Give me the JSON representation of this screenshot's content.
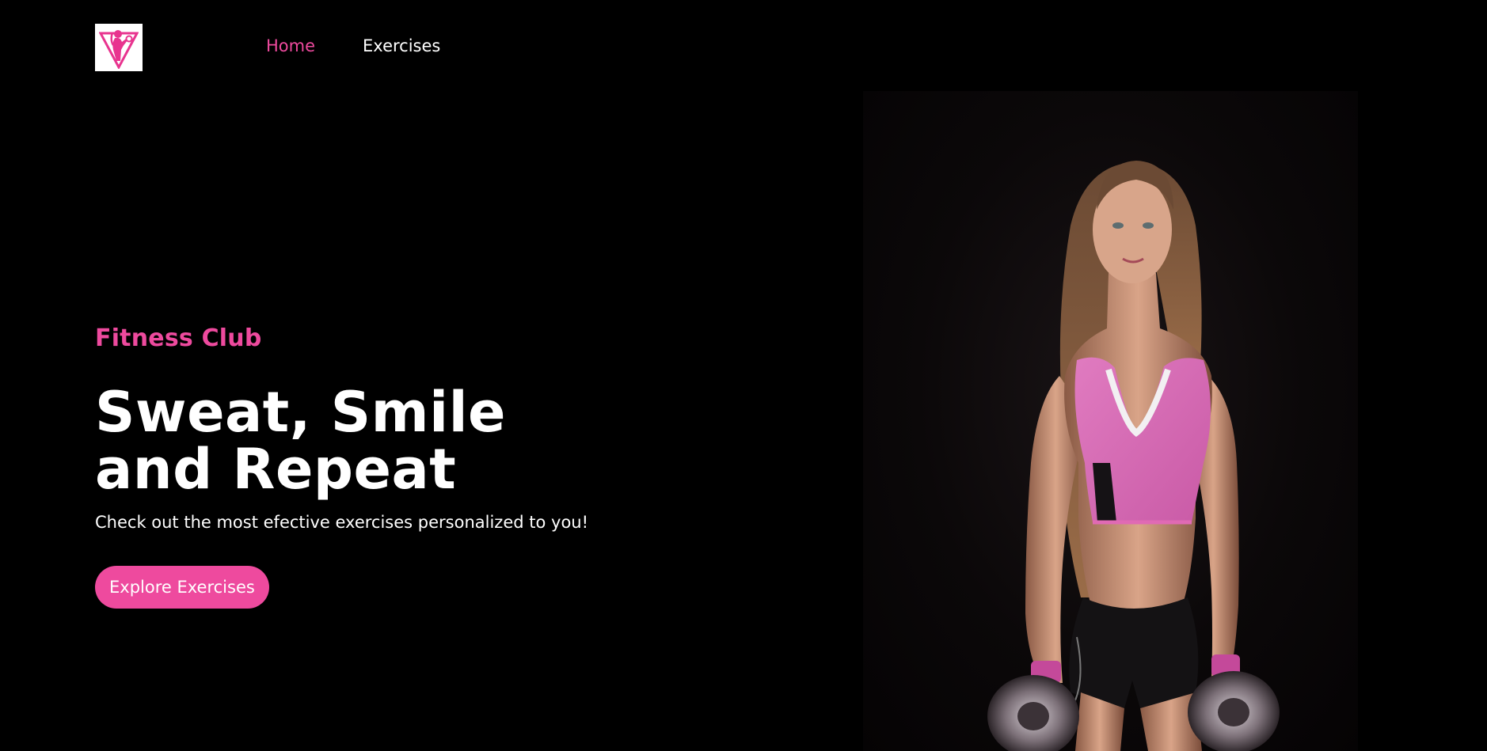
{
  "header": {
    "logo": {
      "icon": "female-fitness-logo-icon",
      "color": "#e8348f"
    },
    "nav": [
      {
        "label": "Home",
        "active": true
      },
      {
        "label": "Exercises",
        "active": false
      }
    ]
  },
  "hero": {
    "kicker": "Fitness Club",
    "headline_line1": "Sweat, Smile",
    "headline_line2": "and Repeat",
    "subtitle": "Check out the most efective exercises personalized to you!",
    "cta_label": "Explore Exercises",
    "image": {
      "icon": "woman-with-dumbbells-photo"
    }
  },
  "colors": {
    "background": "#000000",
    "accent": "#ee4a9e",
    "text": "#ffffff"
  }
}
